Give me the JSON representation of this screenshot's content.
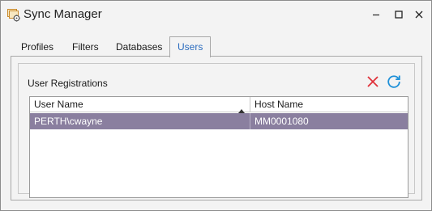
{
  "window": {
    "title": "Sync Manager",
    "icons": {
      "app": "sync-manager-app-icon",
      "minimize": "minimize-icon",
      "maximize": "maximize-icon",
      "close": "close-icon"
    }
  },
  "tabs": [
    {
      "label": "Profiles",
      "active": false
    },
    {
      "label": "Filters",
      "active": false
    },
    {
      "label": "Databases",
      "active": false
    },
    {
      "label": "Users",
      "active": true
    }
  ],
  "users_panel": {
    "section_title": "User Registrations",
    "toolbar": {
      "delete_icon": "delete-x-icon",
      "refresh_icon": "refresh-icon",
      "delete_color": "#e0323a",
      "refresh_color": "#1e90d8"
    },
    "grid": {
      "columns": [
        "User Name",
        "Host Name"
      ],
      "sorted_column": "User Name",
      "sort_direction": "ascending",
      "selected_row_color": "#8a7f9f",
      "rows": [
        {
          "user_name": "PERTH\\cwayne",
          "host_name": "MM0001080",
          "selected": true
        }
      ]
    }
  },
  "colors": {
    "window_bg": "#f3f3f3",
    "active_tab_text": "#2b6cbf"
  }
}
